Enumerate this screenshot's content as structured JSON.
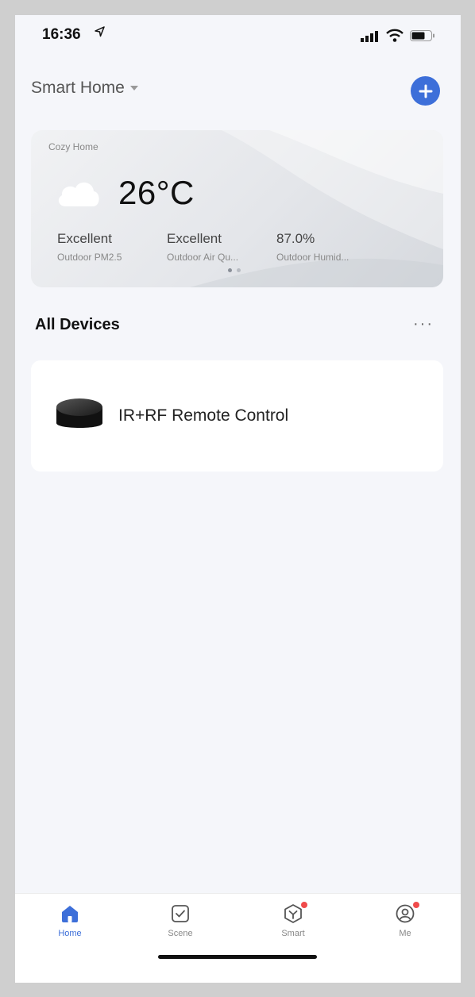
{
  "status": {
    "time": "16:36"
  },
  "header": {
    "home_name": "Smart Home"
  },
  "weather": {
    "card_title": "Cozy Home",
    "temperature": "26°C",
    "stats": [
      {
        "value": "Excellent",
        "label": "Outdoor PM2.5"
      },
      {
        "value": "Excellent",
        "label": "Outdoor Air Qu..."
      },
      {
        "value": "87.0%",
        "label": "Outdoor Humid..."
      }
    ],
    "page_count": 2,
    "active_page": 1
  },
  "section": {
    "title": "All Devices",
    "more": "···"
  },
  "devices": [
    {
      "name": "IR+RF Remote Control"
    }
  ],
  "tabs": [
    {
      "label": "Home",
      "icon": "home-icon",
      "active": true
    },
    {
      "label": "Scene",
      "icon": "scene-icon",
      "active": false
    },
    {
      "label": "Smart",
      "icon": "smart-icon",
      "active": false,
      "badge": true
    },
    {
      "label": "Me",
      "icon": "me-icon",
      "active": false,
      "badge": true
    }
  ],
  "colors": {
    "accent": "#3d6fd9",
    "badge": "#f04b4b",
    "background": "#f5f6fa"
  }
}
